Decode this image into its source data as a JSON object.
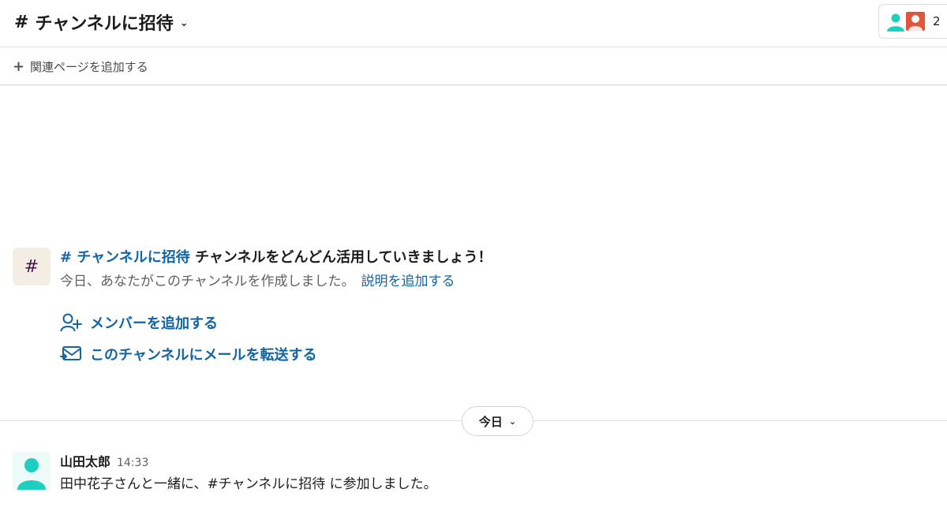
{
  "header": {
    "channel_hash": "#",
    "channel_name": "チャンネルに招待",
    "member_count": "2"
  },
  "bookmarks": {
    "add_label": "関連ページを追加する"
  },
  "intro": {
    "icon_glyph": "#",
    "channel_link": "# チャンネルに招待",
    "headline_rest": " チャンネルをどんどん活用していきましょう！",
    "created_text": "今日、あなたがこのチャンネルを作成しました。",
    "add_description_link": "説明を追加する"
  },
  "actions": {
    "add_members": "メンバーを追加する",
    "forward_email": "このチャンネルにメールを転送する"
  },
  "date_divider": {
    "label": "今日"
  },
  "message": {
    "author": "山田太郎",
    "time": "14:33",
    "text": "田中花子さんと一緒に、#チャンネルに招待 に参加しました。"
  },
  "colors": {
    "link": "#1264a3",
    "avatar_teal": "#1ccfbf",
    "avatar_red": "#e0563a",
    "intro_icon_bg": "#f4ede4"
  }
}
